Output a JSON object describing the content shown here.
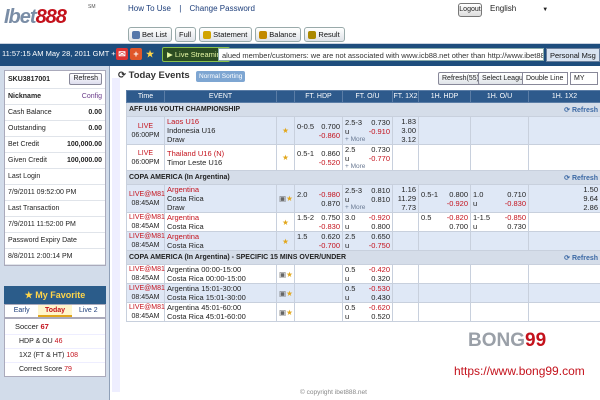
{
  "brand": {
    "logo_a": "Ibet",
    "logo_b": "888",
    "logo_sup": "SM"
  },
  "toplinks": {
    "howto": "How To Use",
    "sep": "|",
    "changepw": "Change Password"
  },
  "logout": "Logout",
  "language": "English",
  "tabs": [
    {
      "label": "Bet List",
      "color": "#5577aa"
    },
    {
      "label": "Full",
      "color": "#ffffff"
    },
    {
      "label": "Statement",
      "color": "#d1a400"
    },
    {
      "label": "Balance",
      "color": "#c28a00"
    },
    {
      "label": "Result",
      "color": "#aa8800"
    }
  ],
  "infobar": {
    "time": "11:57:15 AM   May 28, 2011 GMT +8",
    "live_streaming": "Live Streaming",
    "ticker": "alued member/customers: we are not associated with www.icb88.net other than http://www.ibet888.net",
    "personal": "Personal Msg"
  },
  "account": {
    "id": "SKU3817001",
    "refresh": "Refresh",
    "nickname_label": "Nickname",
    "nickname_value": "Config",
    "rows": [
      {
        "label": "Cash Balance",
        "value": "0.00"
      },
      {
        "label": "Outstanding",
        "value": "0.00"
      },
      {
        "label": "Bet Credit",
        "value": "100,000.00"
      },
      {
        "label": "Given Credit",
        "value": "100,000.00"
      }
    ],
    "last_login_label": "Last Login",
    "last_login_value": "7/9/2011 09:52:00 PM",
    "last_tx_label": "Last Transaction",
    "last_tx_value": "7/9/2011 11:52:00 PM",
    "pw_exp_label": "Password Expiry Date",
    "pw_exp_value": "8/8/2011 2:00:14 PM"
  },
  "favorite": {
    "title": "My Favorite",
    "tabs": [
      "Early",
      "Today",
      "Live 2"
    ],
    "sport": "Soccer",
    "sport_count": "67",
    "items": [
      {
        "label": "HDP & OU",
        "count": "46"
      },
      {
        "label": "1X2 (FT & HT)",
        "count": "108"
      },
      {
        "label": "Correct Score",
        "count": "79"
      }
    ]
  },
  "main": {
    "title": "Today Events",
    "sort": "Normal Sorting",
    "refresh_btn": "Refresh(55)",
    "select_league": "Select League",
    "line_sel": "Double Line",
    "currency_sel": "MY"
  },
  "headers": [
    "Time",
    "EVENT",
    "FT. HDP",
    "FT. O/U",
    "FT. 1X2",
    "1H. HDP",
    "1H. O/U",
    "1H. 1X2"
  ],
  "leagues": [
    {
      "name": "AFF U16 YOUTH CHAMPIONSHIP",
      "refresh": "Refresh",
      "matches": [
        {
          "t1": "LIVE",
          "t2": "06:00PM",
          "home": "Laos U16",
          "away": "Indonesia U16",
          "draw": "Draw",
          "hdp": "0-0.5",
          "hdp_a": "0.700",
          "hdp_b": "-0.860",
          "ou": "2.5-3",
          "ou_u": "u",
          "ou_a": "0.730",
          "ou_b": "-0.910",
          "x1": "1.83",
          "x2": "3.00",
          "x3": "3.12",
          "more": "+ More",
          "fav_home": true
        },
        {
          "t1": "LIVE",
          "t2": "06:00PM",
          "home": "Thailand U16 (N)",
          "away": "Timor Leste U16",
          "draw": "",
          "hdp": "0.5-1",
          "hdp_a": "0.860",
          "hdp_b": "-0.520",
          "ou": "2.5",
          "ou_u": "u",
          "ou_a": "0.730",
          "ou_b": "-0.770",
          "x1": "",
          "x2": "",
          "x3": "",
          "more": "+ More",
          "fav_home": true
        }
      ]
    },
    {
      "name": "COPA AMERICA (In Argentina)",
      "refresh": "Refresh",
      "matches": [
        {
          "t1": "LIVE@M81",
          "t2": "08:45AM",
          "home": "Argentina",
          "away": "Costa Rica",
          "draw": "Draw",
          "hdp": "2.0",
          "hdp_a": "-0.980",
          "hdp_b": "0.870",
          "ou": "2.5-3",
          "ou_u": "u",
          "ou_a": "0.810",
          "ou_b": "0.810",
          "x1": "1.16",
          "x2": "11.29",
          "x3": "7.73",
          "more": "+ More",
          "h1hdp": "0.5-1",
          "h1a": "0.800",
          "h1b": "-0.920",
          "h1ou": "1.0",
          "h1ou_u": "u",
          "h1ou_a": "0.710",
          "h1ou_b": "-0.830",
          "h1x1": "1.50",
          "h1x2": "9.64",
          "h1x3": "2.86"
        },
        {
          "t1": "LIVE@M81",
          "t2": "08:45AM",
          "home": "Argentina",
          "away": "Costa Rica",
          "draw": "",
          "hdp": "1.5-2",
          "hdp_a": "0.750",
          "hdp_b": "-0.830",
          "ou": "3.0",
          "ou_u": "u",
          "ou_a": "-0.920",
          "ou_b": "0.800",
          "x1": "",
          "x2": "",
          "x3": "",
          "h1hdp": "0.5",
          "h1a": "-0.820",
          "h1b": "0.700",
          "h1ou": "1-1.5",
          "h1ou_u": "u",
          "h1ou_a": "-0.850",
          "h1ou_b": "0.730"
        },
        {
          "t1": "LIVE@M81",
          "t2": "08:45AM",
          "home": "Argentina",
          "away": "Costa Rica",
          "draw": "",
          "hdp": "1.5",
          "hdp_a": "0.620",
          "hdp_b": "-0.700",
          "ou": "2.5",
          "ou_u": "u",
          "ou_a": "0.650",
          "ou_b": "-0.750",
          "x1": "",
          "x2": "",
          "x3": ""
        }
      ]
    },
    {
      "name": "COPA AMERICA (In Argentina) - SPECIFIC 15 MINS OVER/UNDER",
      "refresh": "Refresh",
      "matches": [
        {
          "t1": "LIVE@M81",
          "t2": "08:45AM",
          "home": "Argentina 00:00-15:00",
          "away": "Costa Rica 00:00-15:00",
          "ou": "0.5",
          "ou_u": "u",
          "ou_a": "-0.420",
          "ou_b": "0.320"
        },
        {
          "t1": "LIVE@M81",
          "t2": "08:45AM",
          "home": "Argentina 15:01-30:00",
          "away": "Costa Rica 15:01-30:00",
          "ou": "0.5",
          "ou_u": "u",
          "ou_a": "-0.530",
          "ou_b": "0.430"
        },
        {
          "t1": "LIVE@M81",
          "t2": "08:45AM",
          "home": "Argentina 45:01-60:00",
          "away": "Costa Rica 45:01-60:00",
          "ou": "0.5",
          "ou_u": "u",
          "ou_a": "-0.620",
          "ou_b": "0.520"
        }
      ]
    }
  ],
  "watermark": {
    "brand_a": "BONG",
    "brand_b": "99",
    "url": "https://www.bong99.com"
  },
  "copyright": "© copyright ibet888.net"
}
